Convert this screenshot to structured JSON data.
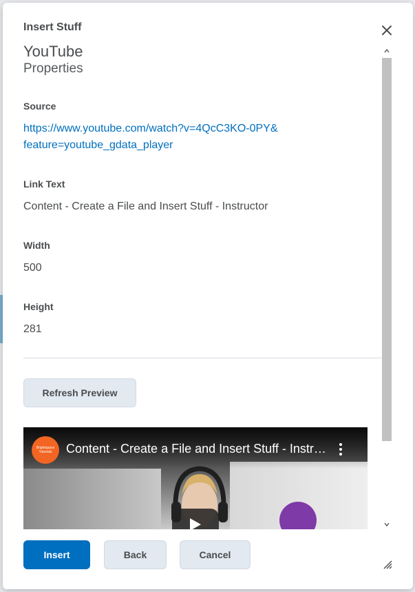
{
  "dialog": {
    "title": "Insert Stuff",
    "heading": "YouTube",
    "subheading": "Properties"
  },
  "fields": {
    "source_label": "Source",
    "source_value_line1": "https://www.youtube.com/watch?v=4QcC3KO-0PY&",
    "source_value_line2": "feature=youtube_gdata_player",
    "link_text_label": "Link Text",
    "link_text_value": "Content - Create a File and Insert Stuff - Instructor",
    "width_label": "Width",
    "width_value": "500",
    "height_label": "Height",
    "height_value": "281"
  },
  "buttons": {
    "refresh_preview": "Refresh Preview",
    "insert": "Insert",
    "back": "Back",
    "cancel": "Cancel"
  },
  "video_preview": {
    "title": "Content - Create a File and Insert Stuff - Instructor",
    "channel_logo_text": "Brightspace Tutorials"
  },
  "icons": {
    "close": "close-icon",
    "play": "play-icon",
    "menu": "more-vertical-icon",
    "resize": "resize-handle-icon"
  },
  "colors": {
    "primary": "#006fbf",
    "link": "#006fbf",
    "secondary_button": "#e3e9f1",
    "text": "#494c4e",
    "channel_logo": "#f26522"
  }
}
